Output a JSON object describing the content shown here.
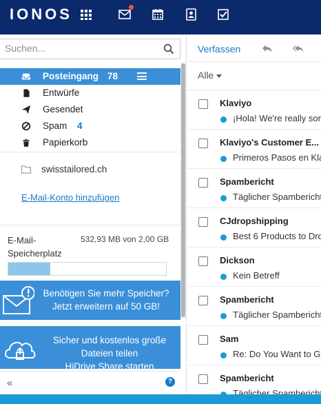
{
  "app": {
    "logo": "IONOS"
  },
  "topnav": {
    "icons": [
      "apps-grid-icon",
      "mail-icon",
      "calendar-icon",
      "contacts-icon",
      "tasks-icon"
    ]
  },
  "search": {
    "placeholder": "Suchen..."
  },
  "folders": [
    {
      "label": "Posteingang",
      "count": "78",
      "icon": "inbox-icon",
      "active": true
    },
    {
      "label": "Entwürfe",
      "count": "",
      "icon": "draft-icon",
      "active": false
    },
    {
      "label": "Gesendet",
      "count": "",
      "icon": "send-icon",
      "active": false
    },
    {
      "label": "Spam",
      "count": "4",
      "icon": "spam-icon",
      "active": false
    },
    {
      "label": "Papierkorb",
      "count": "",
      "icon": "trash-icon",
      "active": false
    }
  ],
  "account": {
    "name": "swisstailored.ch",
    "add_link": "E-Mail-Konto hinzufügen"
  },
  "storage": {
    "label": "E-Mail-Speicherplatz",
    "value": "532,93 MB von 2,00 GB",
    "fraction": 0.266
  },
  "promo1": {
    "line1": "Benötigen Sie mehr Speicher?",
    "line2": "Jetzt erweitern auf 50 GB!"
  },
  "promo2": {
    "line1": "Sicher und kostenlos große",
    "line2": "Dateien teilen",
    "line3": "HiDrive Share starten"
  },
  "sidebar_footer": {
    "collapse": "«",
    "help": "?"
  },
  "toolbar": {
    "compose": "Verfassen"
  },
  "filter": {
    "label": "Alle"
  },
  "messages": [
    {
      "sender": "Klaviyo",
      "subject": "¡Hola! We're really sor"
    },
    {
      "sender": "Klaviyo's Customer E...",
      "subject": "Primeros Pasos en Kla"
    },
    {
      "sender": "Spambericht",
      "subject": "Täglicher Spambericht"
    },
    {
      "sender": "CJdropshipping",
      "subject": "Best 6 Products to Dro"
    },
    {
      "sender": "Dickson",
      "subject": "Kein Betreff"
    },
    {
      "sender": "Spambericht",
      "subject": "Täglicher Spambericht"
    },
    {
      "sender": "Sam",
      "subject": "Re: Do You Want to Gr"
    },
    {
      "sender": "Spambericht",
      "subject": "Täglicher Spambericht"
    }
  ],
  "colors": {
    "topbar": "#0b2a6b",
    "accent": "#3a8fd8",
    "link": "#1a7ac9",
    "unread_dot": "#1a9bd8"
  }
}
